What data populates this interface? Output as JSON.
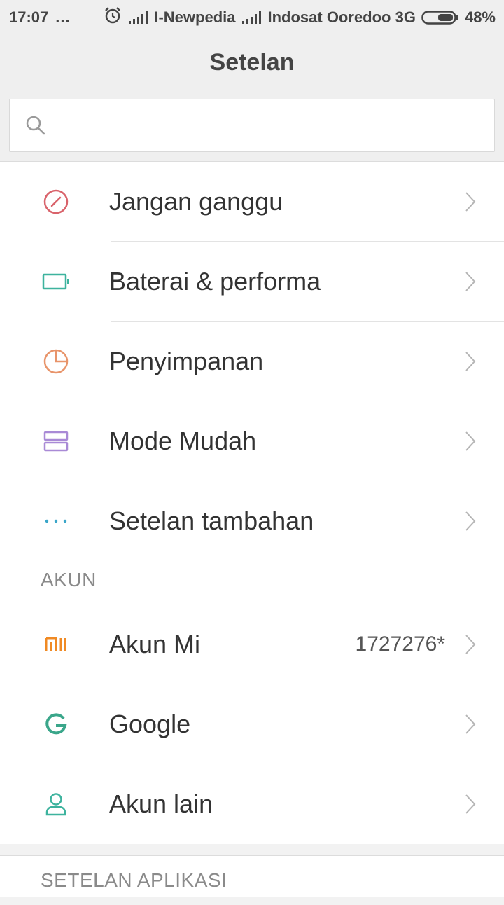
{
  "status_bar": {
    "time": "17:07",
    "dots": "...",
    "carrier1": "I-Newpedia",
    "carrier2": "Indosat Ooredoo 3G",
    "battery": "48%"
  },
  "header": {
    "title": "Setelan"
  },
  "search": {
    "placeholder": "",
    "value": ""
  },
  "group1": {
    "items": [
      {
        "label": "Jangan ganggu",
        "icon": "do-not-disturb-icon"
      },
      {
        "label": "Baterai & performa",
        "icon": "battery-icon"
      },
      {
        "label": "Penyimpanan",
        "icon": "storage-pie-icon"
      },
      {
        "label": "Mode Mudah",
        "icon": "easy-mode-icon"
      },
      {
        "label": "Setelan tambahan",
        "icon": "more-dots-icon"
      }
    ]
  },
  "accounts": {
    "header": "AKUN",
    "items": [
      {
        "label": "Akun Mi",
        "value": "1727276*",
        "icon": "mi-logo-icon"
      },
      {
        "label": "Google",
        "icon": "google-g-icon"
      },
      {
        "label": "Akun lain",
        "icon": "person-icon"
      }
    ]
  },
  "app_settings": {
    "header": "SETELAN APLIKASI"
  },
  "colors": {
    "dnd": "#d9636b",
    "battery": "#3db39e",
    "storage": "#e8946a",
    "easy_mode": "#a98ad6",
    "more": "#3aa6c9",
    "mi": "#f08a24",
    "google": "#3aa68a",
    "person": "#3db39e"
  }
}
